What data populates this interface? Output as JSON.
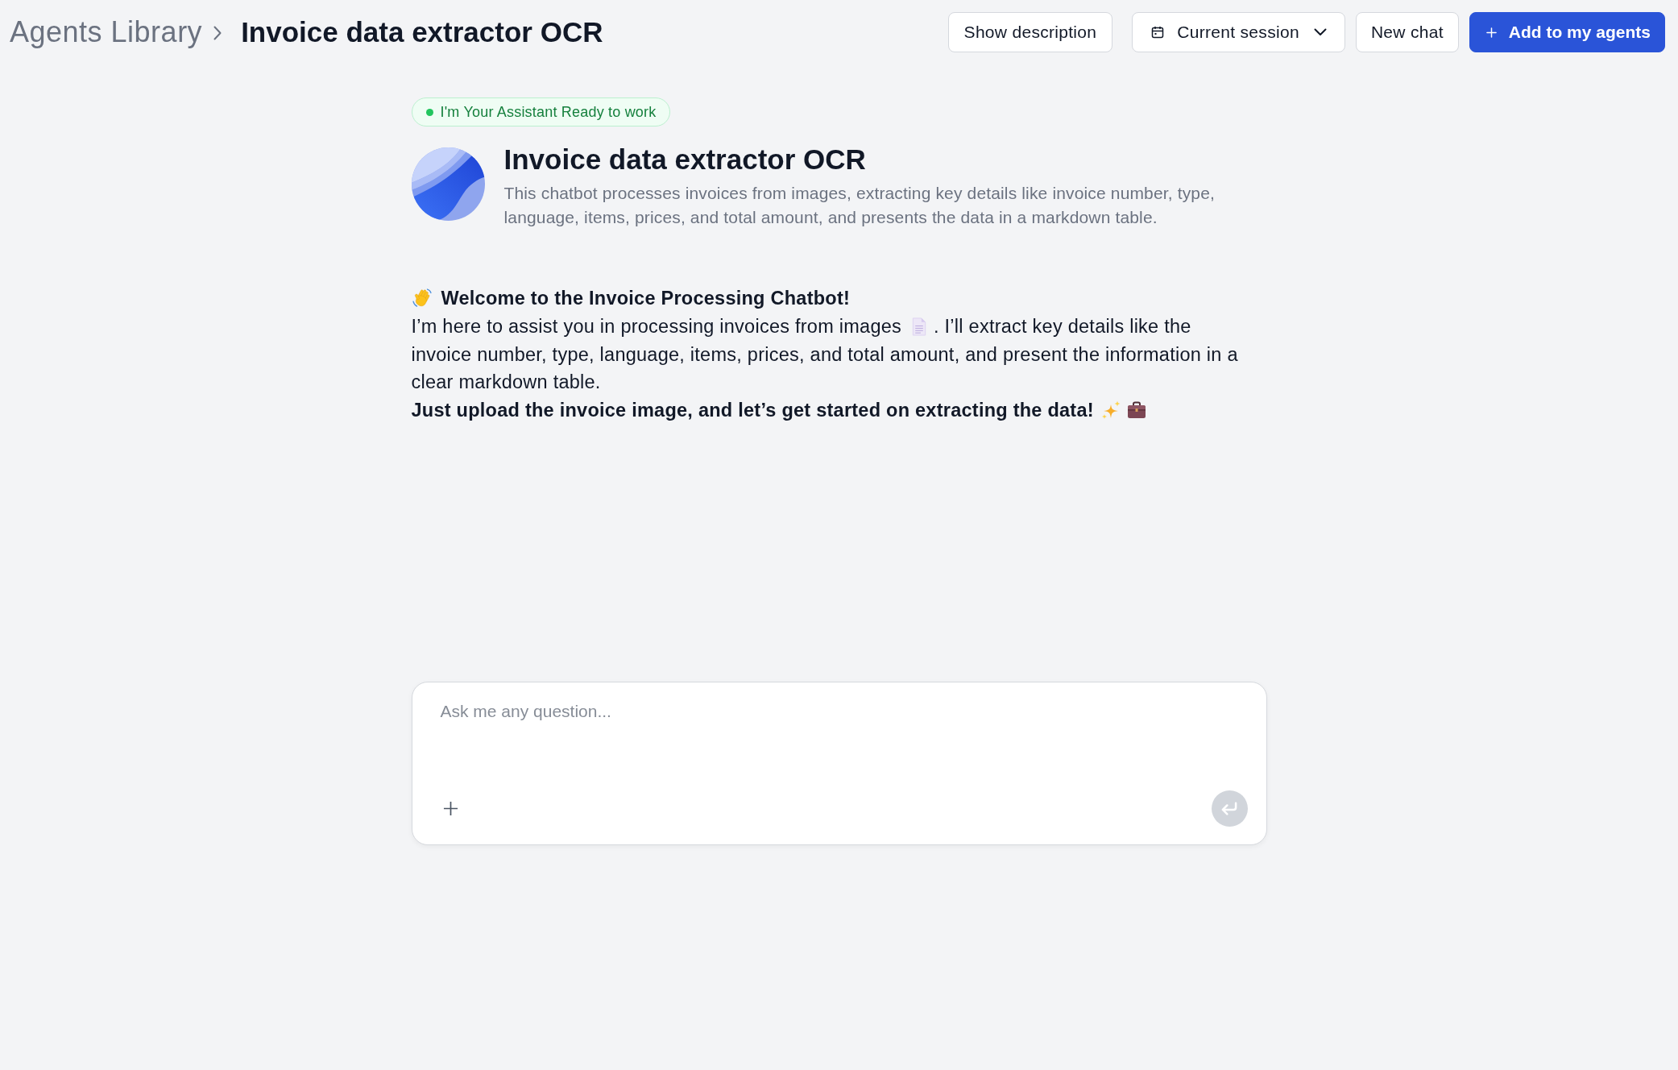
{
  "breadcrumb": {
    "parent": "Agents Library",
    "current": "Invoice data extractor OCR"
  },
  "header_actions": [
    {
      "kind": "button",
      "label": "Show description"
    },
    {
      "kind": "dropdown",
      "label": "Current session"
    },
    {
      "kind": "button",
      "label": "New chat"
    },
    {
      "kind": "primary",
      "label": "Add to my agents"
    }
  ],
  "agent": {
    "status_badge": "I'm Your Assistant Ready to work",
    "name": "Invoice data extractor OCR",
    "description": "This chatbot processes invoices from images, extracting key details like invoice number, type, language, items, prices, and total amount, and presents the data in a markdown table."
  },
  "welcome_message": {
    "heading": "Welcome to the Invoice Processing Chatbot!",
    "intro": "I’m here to assist you in processing invoices from images",
    "detail_lines": [
      ". I’ll extract key details like the",
      "invoice number, type, language, items, prices, and total amount, and present the information in a",
      "clear markdown table."
    ],
    "closing": "Just upload the invoice image, and let’s get started on extracting the data!"
  },
  "composer": {
    "placeholder": "Ask me any question...",
    "send_button": {
      "disabled": true
    }
  }
}
